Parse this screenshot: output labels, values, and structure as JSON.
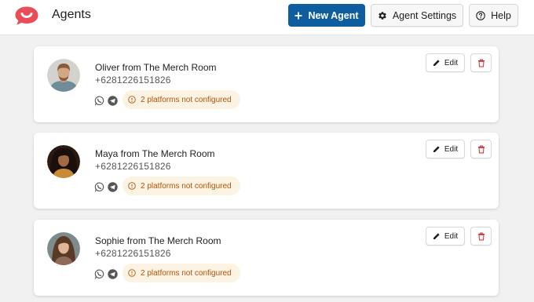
{
  "header": {
    "title": "Agents",
    "new_agent_label": "New Agent",
    "settings_label": "Agent Settings",
    "help_label": "Help"
  },
  "agents": [
    {
      "name": "Oliver from The Merch Room",
      "phone": "+6281226151826",
      "warning": "2 platforms not configured",
      "edit_label": "Edit"
    },
    {
      "name": "Maya from The Merch Room",
      "phone": "+6281226151826",
      "warning": "2 platforms not configured",
      "edit_label": "Edit"
    },
    {
      "name": "Sophie from The Merch Room",
      "phone": "+6281226151826",
      "warning": "2 platforms not configured",
      "edit_label": "Edit"
    }
  ],
  "colors": {
    "brand": "#ea4d58",
    "primary_button": "#0e5e9f",
    "warning_bg": "#fcf3e2",
    "warning_text": "#b0540e",
    "delete_icon": "#cc2b2b"
  },
  "icons": {
    "logo": "chat-bubble-smile-logo",
    "new_agent": "plus-icon",
    "settings": "gear-icon",
    "help": "question-circle-icon",
    "edit": "pencil-icon",
    "delete": "trash-icon",
    "platforms": [
      "whatsapp-icon",
      "telegram-icon"
    ],
    "warning": "info-circle-icon"
  }
}
